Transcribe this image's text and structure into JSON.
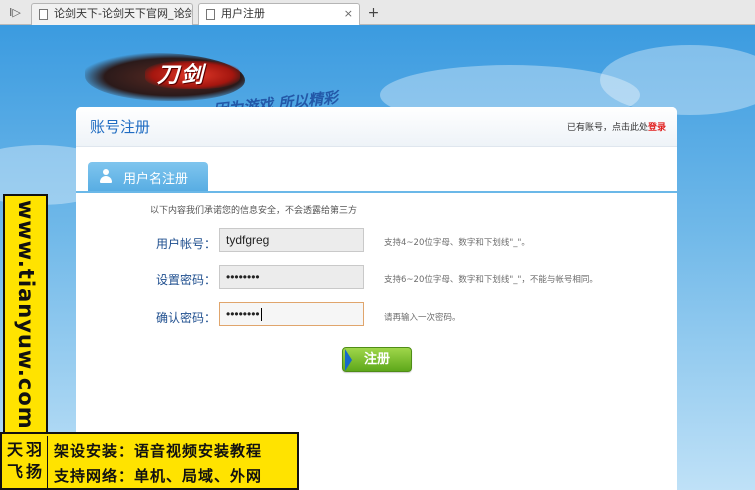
{
  "browser": {
    "tabs": [
      {
        "title": "论剑天下-论剑天下官网_论剑天",
        "active": false
      },
      {
        "title": "用户注册",
        "active": true
      }
    ],
    "new_tab_symbol": "+",
    "close_symbol": "×",
    "arrow_symbol": "I▷"
  },
  "logo": {
    "name": "刀剑",
    "slogan": "因为游戏 所以精彩"
  },
  "panel": {
    "title": "账号注册",
    "have_account_text": "已有账号，点击此处",
    "login_link": "登录"
  },
  "tab": {
    "label": "用户名注册",
    "icon": "user-icon"
  },
  "form": {
    "notice": "以下内容我们承诺您的信息安全，不会透露给第三方",
    "username": {
      "label": "用户帐号：",
      "value": "tydfgreg",
      "hint": "支持4~20位字母、数字和下划线\"_\"。"
    },
    "password": {
      "label": "设置密码：",
      "value": "••••••••",
      "hint": "支持6~20位字母、数字和下划线\"_\"，不能与帐号相同。"
    },
    "confirm": {
      "label": "确认密码：",
      "value": "••••••••",
      "hint": "请再输入一次密码。"
    },
    "submit_label": "注册"
  },
  "watermark": {
    "url": "www.tianyuw.com",
    "seal": [
      "天",
      "羽",
      "飞",
      "扬"
    ],
    "line1": "架设安装：语音视频安装教程",
    "line2": "支持网络：单机、局域、外网"
  },
  "colors": {
    "accent_blue": "#1f6cc2",
    "login_red": "#e1201f",
    "button_green": "#6bb52a",
    "watermark_yellow": "#ffe300"
  }
}
